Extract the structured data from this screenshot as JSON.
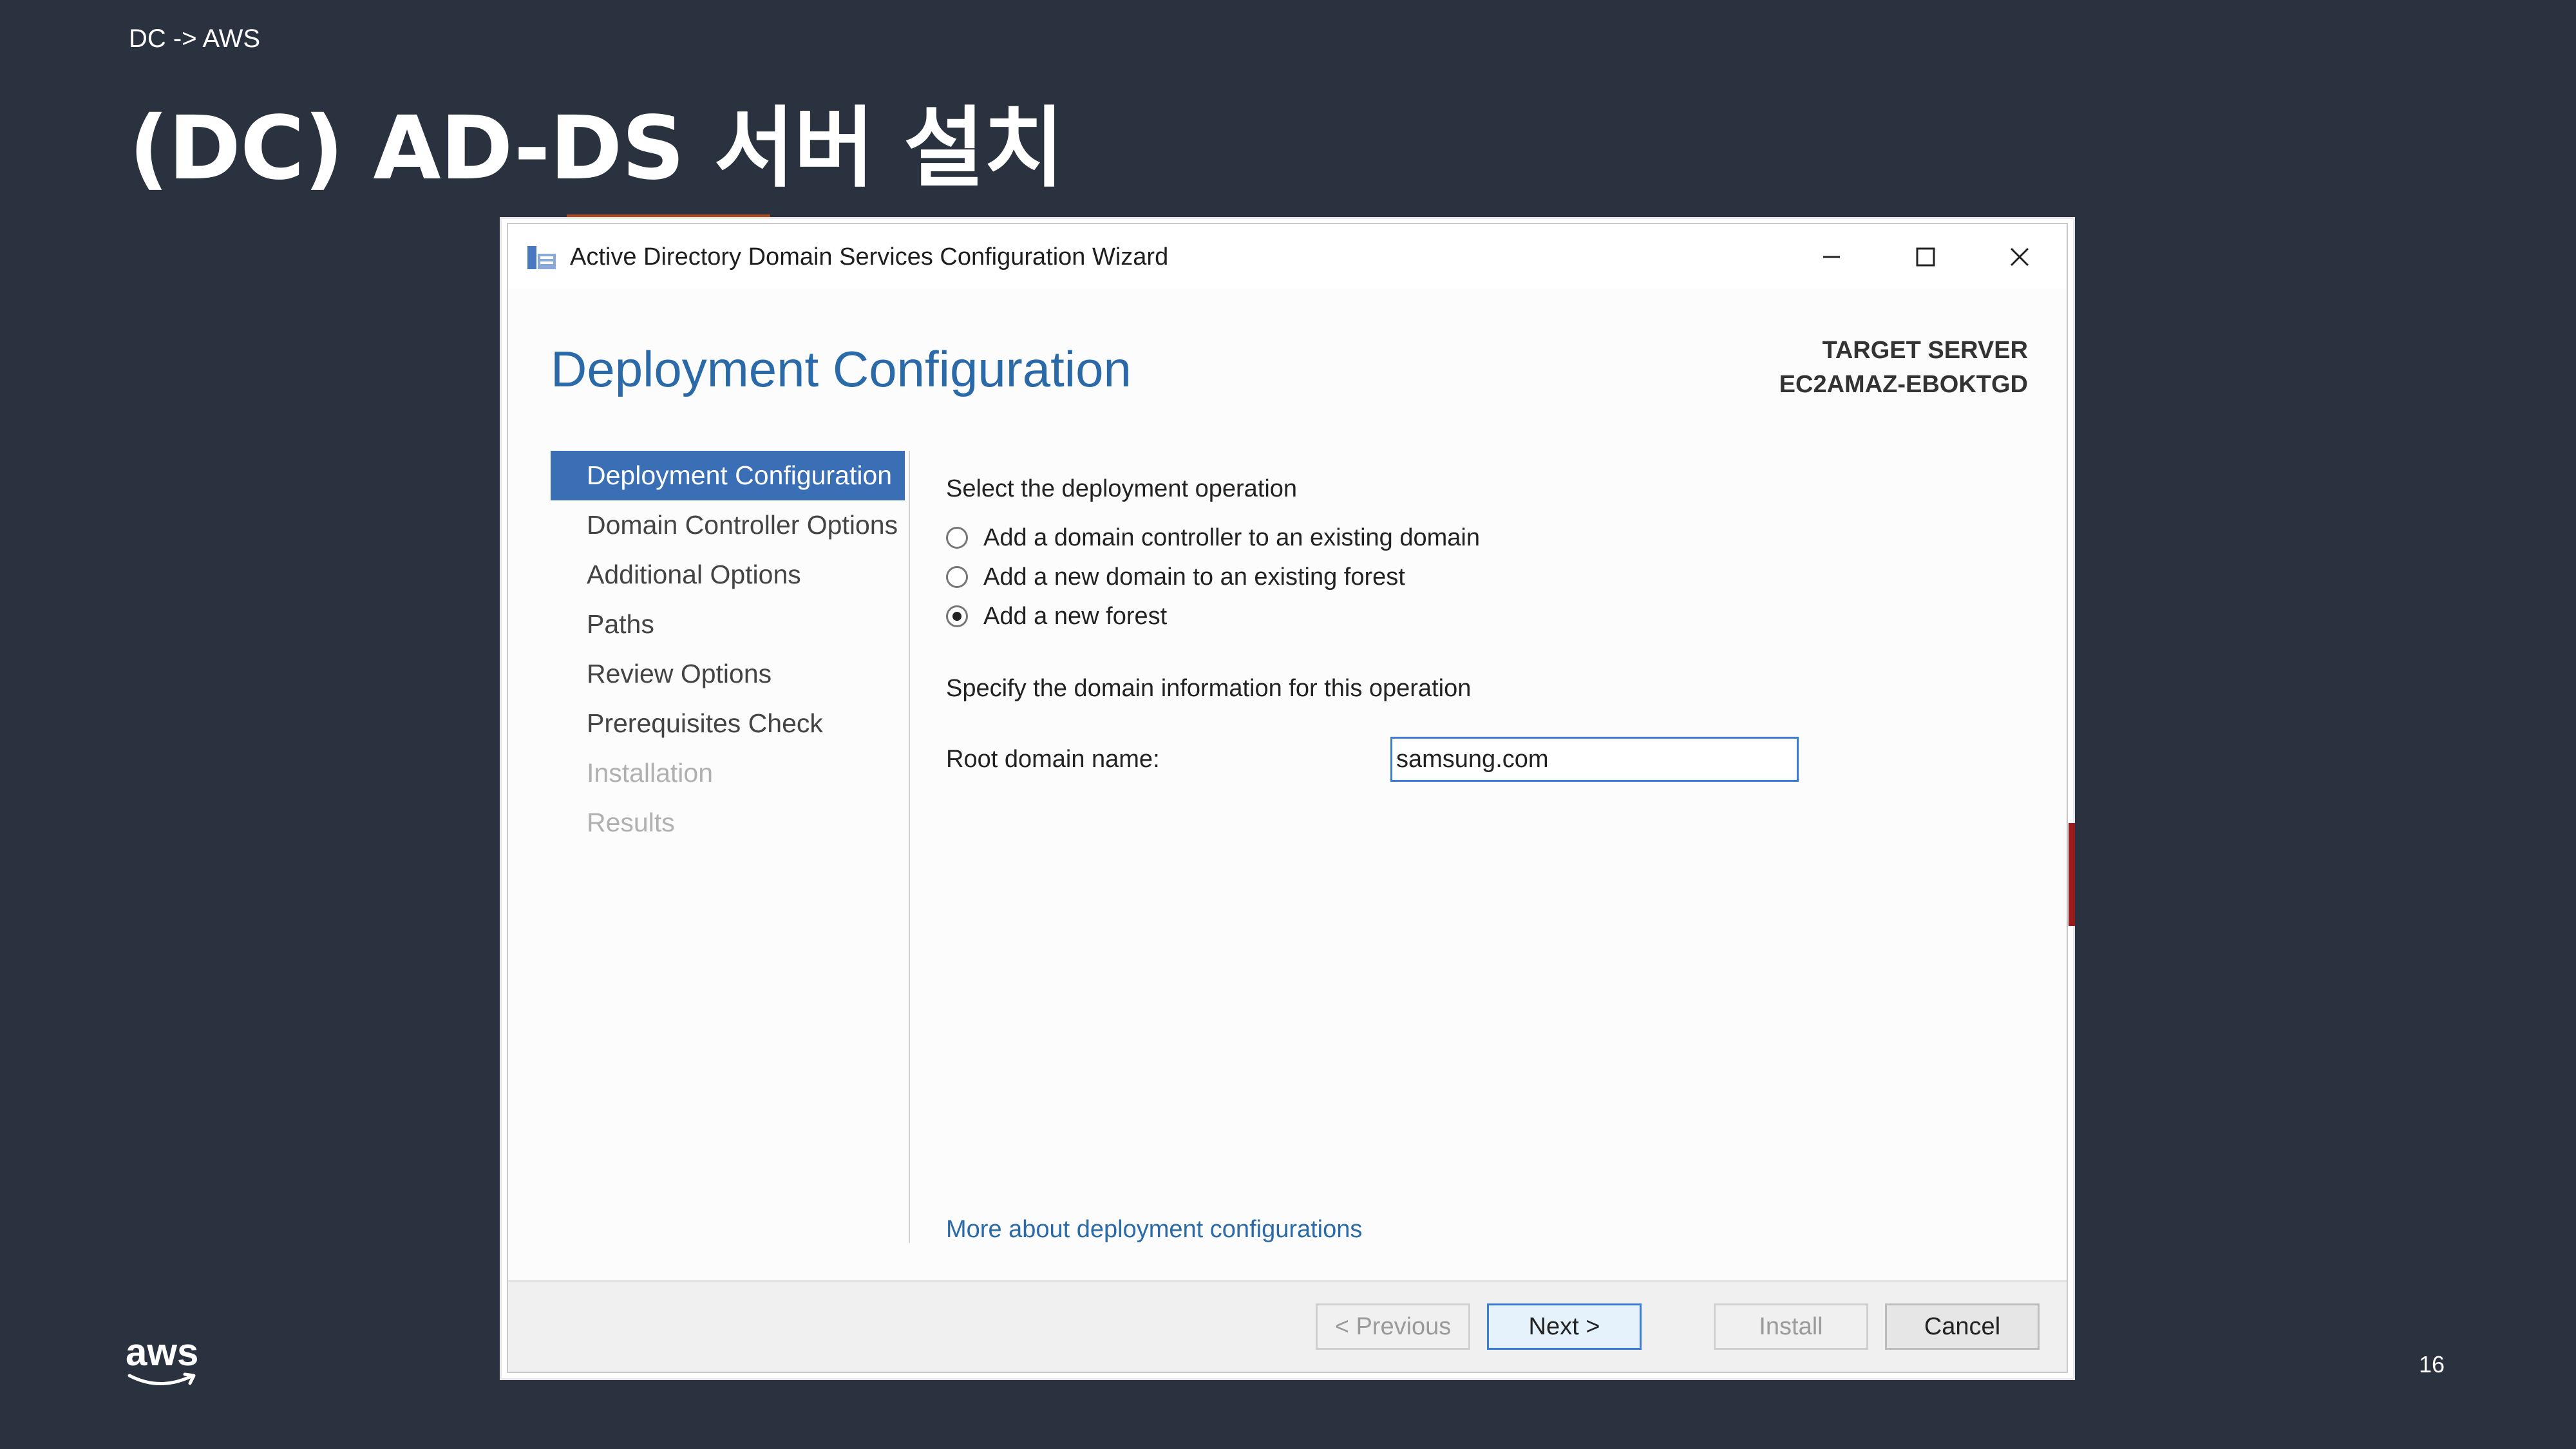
{
  "slide": {
    "breadcrumb": "DC -> AWS",
    "title": "(DC) AD-DS 서버 설치",
    "page_number": "16",
    "logo_text": "aws"
  },
  "window": {
    "title": "Active Directory Domain Services Configuration Wizard",
    "controls": [
      "minimize-icon",
      "maximize-icon",
      "close-icon"
    ],
    "heading": "Deployment Configuration",
    "target_server_label": "TARGET SERVER",
    "target_server_name": "EC2AMAZ-EBOKTGD"
  },
  "nav": {
    "items": [
      {
        "label": "Deployment Configuration",
        "state": "active"
      },
      {
        "label": "Domain Controller Options",
        "state": "enabled"
      },
      {
        "label": "Additional Options",
        "state": "enabled"
      },
      {
        "label": "Paths",
        "state": "enabled"
      },
      {
        "label": "Review Options",
        "state": "enabled"
      },
      {
        "label": "Prerequisites Check",
        "state": "enabled"
      },
      {
        "label": "Installation",
        "state": "disabled"
      },
      {
        "label": "Results",
        "state": "disabled"
      }
    ]
  },
  "main": {
    "operation_label": "Select the deployment operation",
    "options": [
      {
        "label": "Add a domain controller to an existing domain",
        "checked": false
      },
      {
        "label": "Add a new domain to an existing forest",
        "checked": false
      },
      {
        "label": "Add a new forest",
        "checked": true
      }
    ],
    "domain_info_label": "Specify the domain information for this operation",
    "root_domain_label": "Root domain name:",
    "root_domain_value": "samsung.com",
    "more_link": "More about deployment configurations"
  },
  "footer": {
    "previous": "< Previous",
    "next": "Next >",
    "install": "Install",
    "cancel": "Cancel"
  },
  "colors": {
    "slide_background": "#2a3240",
    "accent_blue": "#3a6fb5",
    "heading_blue": "#2a6aa8"
  }
}
